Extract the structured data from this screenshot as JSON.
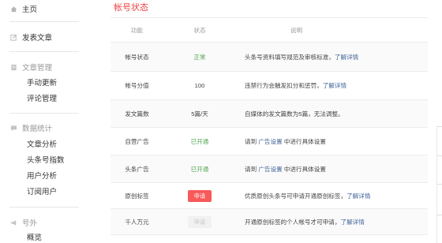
{
  "sidebar": {
    "home": "主页",
    "publish": "发表文章",
    "article_mgmt": "文章管理",
    "manual_update": "手动更新",
    "comment_mgmt": "评论管理",
    "data_stats": "数据统计",
    "article_analysis": "文章分析",
    "index": "头条号指数",
    "user_analysis": "用户分析",
    "subscribers": "订阅用户",
    "other": "号外",
    "overview": "概览"
  },
  "page": {
    "title": "帐号状态"
  },
  "table": {
    "headers": {
      "func": "功能",
      "status": "状态",
      "desc": "说明"
    },
    "rows": [
      {
        "func": "帐号状态",
        "status": "正常",
        "desc": "头条号资料填写规范及审核标准，",
        "link": "了解详情"
      },
      {
        "func": "帐号分值",
        "status": "100",
        "desc": "违禁行为会触发扣分和惩罚，",
        "link": "了解详情"
      },
      {
        "func": "发文篇数",
        "status": "5篇/天",
        "desc": "自媒体的发文篇数为5篇，无法调整。"
      },
      {
        "func": "自营广告",
        "status": "已开通",
        "desc_pre": "请到",
        "link": "广告设置",
        "desc_post": "中进行具体设置"
      },
      {
        "func": "头条广告",
        "status": "已开通",
        "desc_pre": "请到",
        "link": "广告设置",
        "desc_post": "中进行具体设置"
      },
      {
        "func": "原创标签",
        "status": "申请",
        "desc": "优质原创头条号可申请开通原创标签，",
        "link": "了解详情"
      },
      {
        "func": "千人万元",
        "status": "申请",
        "desc": "开通原创标签的个人帐号才可申请，",
        "link": "了解详情"
      }
    ]
  },
  "colors": {
    "accent": "#f04142",
    "green": "#4fa64f",
    "link": "#406599",
    "apply": "#f85959"
  }
}
